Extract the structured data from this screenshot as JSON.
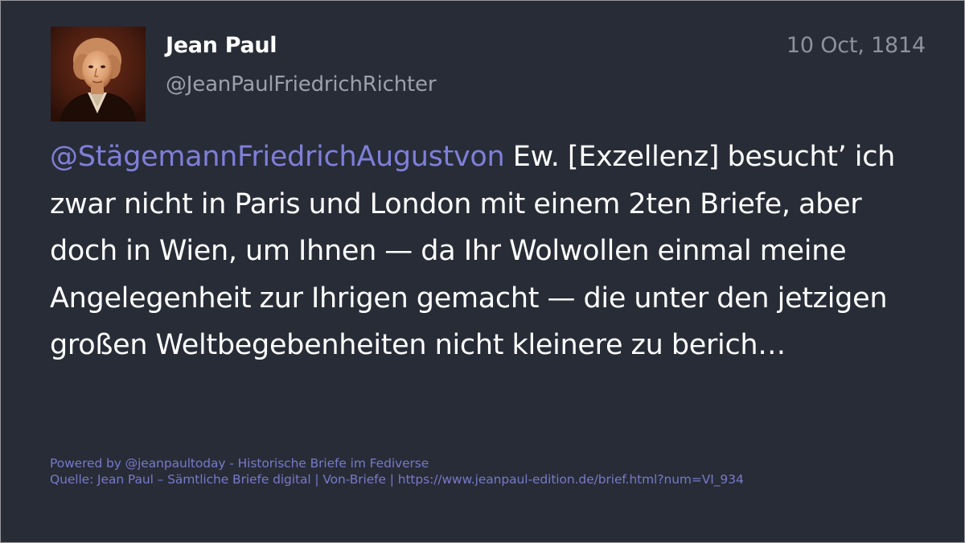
{
  "post": {
    "display_name": "Jean Paul",
    "handle": "@JeanPaulFriedrichRichter",
    "date": "10 Oct, 1814",
    "mention": "@StägemannFriedrichAugustvon",
    "body": " Ew. [Exzellenz] besucht’ ich zwar nicht in Paris und London mit einem 2ten Briefe, aber doch in Wien, um Ihnen — da Ihr Wolwollen einmal meine Angelegenheit zur Ihrigen gemacht — die unter den jetzigen großen Weltbegebenheiten nicht kleinere zu berich…"
  },
  "footer": {
    "powered_by": "Powered by @jeanpaultoday - Historische Briefe im Fediverse",
    "source": "Quelle: Jean Paul – Sämtliche Briefe digital | Von-Briefe | https://www.jeanpaul-edition.de/brief.html?num=VI_934"
  },
  "colors": {
    "card_background": "#282c37",
    "mention": "#7f7fd9",
    "footer_link": "#7779c9",
    "muted_text": "#9ba0ab"
  },
  "icons": {
    "avatar": "portrait-painting"
  }
}
